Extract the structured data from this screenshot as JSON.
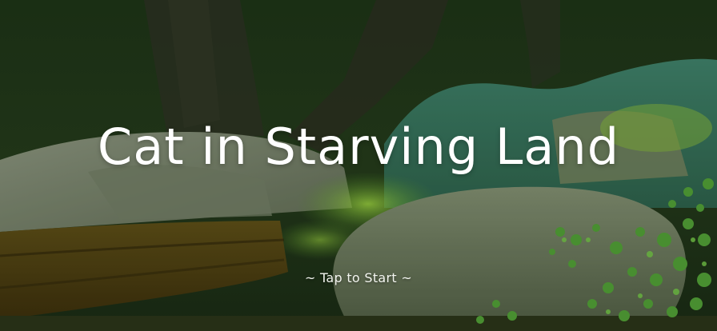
{
  "game": {
    "title": "Cat in Starving Land",
    "prompt": "~ Tap to Start ~"
  },
  "scene": {
    "description_icon": "forest-background",
    "palette": {
      "sky_dark": "#1f3318",
      "tree_trunk": "#2a2f22",
      "rock_gray": "#6f7a63",
      "moss_green": "#7fbf3a",
      "foliage_green": "#3f8a2e",
      "log_brown": "#4a3a12",
      "teal_rock": "#3f7f63"
    }
  }
}
